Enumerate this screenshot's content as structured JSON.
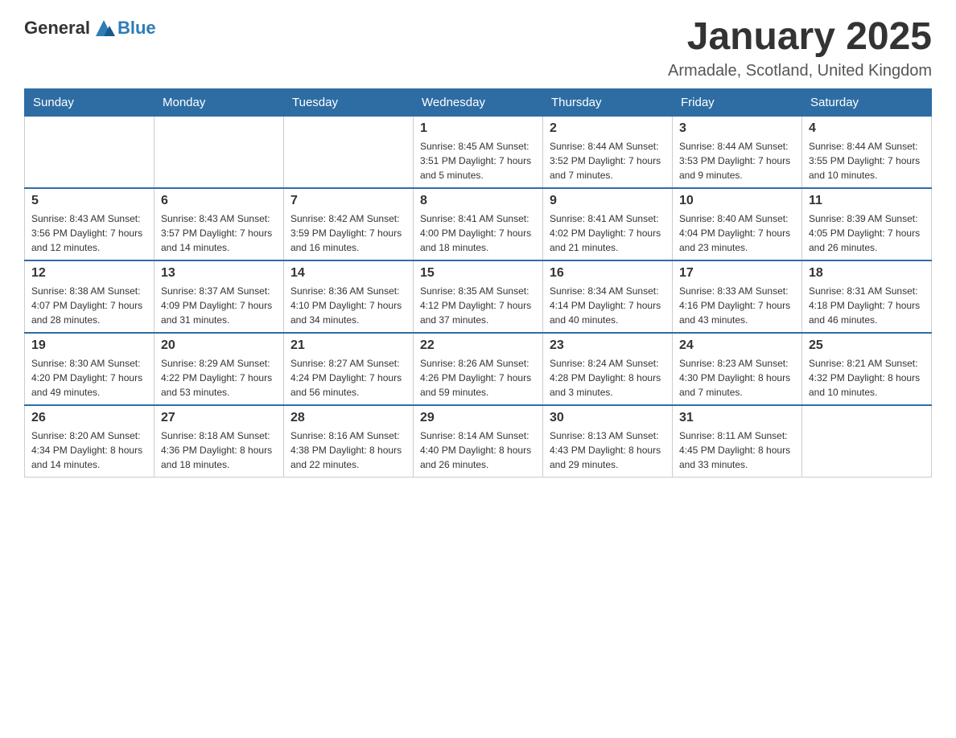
{
  "header": {
    "logo_general": "General",
    "logo_blue": "Blue",
    "month_title": "January 2025",
    "location": "Armadale, Scotland, United Kingdom"
  },
  "weekdays": [
    "Sunday",
    "Monday",
    "Tuesday",
    "Wednesday",
    "Thursday",
    "Friday",
    "Saturday"
  ],
  "weeks": [
    [
      {
        "day": "",
        "info": ""
      },
      {
        "day": "",
        "info": ""
      },
      {
        "day": "",
        "info": ""
      },
      {
        "day": "1",
        "info": "Sunrise: 8:45 AM\nSunset: 3:51 PM\nDaylight: 7 hours\nand 5 minutes."
      },
      {
        "day": "2",
        "info": "Sunrise: 8:44 AM\nSunset: 3:52 PM\nDaylight: 7 hours\nand 7 minutes."
      },
      {
        "day": "3",
        "info": "Sunrise: 8:44 AM\nSunset: 3:53 PM\nDaylight: 7 hours\nand 9 minutes."
      },
      {
        "day": "4",
        "info": "Sunrise: 8:44 AM\nSunset: 3:55 PM\nDaylight: 7 hours\nand 10 minutes."
      }
    ],
    [
      {
        "day": "5",
        "info": "Sunrise: 8:43 AM\nSunset: 3:56 PM\nDaylight: 7 hours\nand 12 minutes."
      },
      {
        "day": "6",
        "info": "Sunrise: 8:43 AM\nSunset: 3:57 PM\nDaylight: 7 hours\nand 14 minutes."
      },
      {
        "day": "7",
        "info": "Sunrise: 8:42 AM\nSunset: 3:59 PM\nDaylight: 7 hours\nand 16 minutes."
      },
      {
        "day": "8",
        "info": "Sunrise: 8:41 AM\nSunset: 4:00 PM\nDaylight: 7 hours\nand 18 minutes."
      },
      {
        "day": "9",
        "info": "Sunrise: 8:41 AM\nSunset: 4:02 PM\nDaylight: 7 hours\nand 21 minutes."
      },
      {
        "day": "10",
        "info": "Sunrise: 8:40 AM\nSunset: 4:04 PM\nDaylight: 7 hours\nand 23 minutes."
      },
      {
        "day": "11",
        "info": "Sunrise: 8:39 AM\nSunset: 4:05 PM\nDaylight: 7 hours\nand 26 minutes."
      }
    ],
    [
      {
        "day": "12",
        "info": "Sunrise: 8:38 AM\nSunset: 4:07 PM\nDaylight: 7 hours\nand 28 minutes."
      },
      {
        "day": "13",
        "info": "Sunrise: 8:37 AM\nSunset: 4:09 PM\nDaylight: 7 hours\nand 31 minutes."
      },
      {
        "day": "14",
        "info": "Sunrise: 8:36 AM\nSunset: 4:10 PM\nDaylight: 7 hours\nand 34 minutes."
      },
      {
        "day": "15",
        "info": "Sunrise: 8:35 AM\nSunset: 4:12 PM\nDaylight: 7 hours\nand 37 minutes."
      },
      {
        "day": "16",
        "info": "Sunrise: 8:34 AM\nSunset: 4:14 PM\nDaylight: 7 hours\nand 40 minutes."
      },
      {
        "day": "17",
        "info": "Sunrise: 8:33 AM\nSunset: 4:16 PM\nDaylight: 7 hours\nand 43 minutes."
      },
      {
        "day": "18",
        "info": "Sunrise: 8:31 AM\nSunset: 4:18 PM\nDaylight: 7 hours\nand 46 minutes."
      }
    ],
    [
      {
        "day": "19",
        "info": "Sunrise: 8:30 AM\nSunset: 4:20 PM\nDaylight: 7 hours\nand 49 minutes."
      },
      {
        "day": "20",
        "info": "Sunrise: 8:29 AM\nSunset: 4:22 PM\nDaylight: 7 hours\nand 53 minutes."
      },
      {
        "day": "21",
        "info": "Sunrise: 8:27 AM\nSunset: 4:24 PM\nDaylight: 7 hours\nand 56 minutes."
      },
      {
        "day": "22",
        "info": "Sunrise: 8:26 AM\nSunset: 4:26 PM\nDaylight: 7 hours\nand 59 minutes."
      },
      {
        "day": "23",
        "info": "Sunrise: 8:24 AM\nSunset: 4:28 PM\nDaylight: 8 hours\nand 3 minutes."
      },
      {
        "day": "24",
        "info": "Sunrise: 8:23 AM\nSunset: 4:30 PM\nDaylight: 8 hours\nand 7 minutes."
      },
      {
        "day": "25",
        "info": "Sunrise: 8:21 AM\nSunset: 4:32 PM\nDaylight: 8 hours\nand 10 minutes."
      }
    ],
    [
      {
        "day": "26",
        "info": "Sunrise: 8:20 AM\nSunset: 4:34 PM\nDaylight: 8 hours\nand 14 minutes."
      },
      {
        "day": "27",
        "info": "Sunrise: 8:18 AM\nSunset: 4:36 PM\nDaylight: 8 hours\nand 18 minutes."
      },
      {
        "day": "28",
        "info": "Sunrise: 8:16 AM\nSunset: 4:38 PM\nDaylight: 8 hours\nand 22 minutes."
      },
      {
        "day": "29",
        "info": "Sunrise: 8:14 AM\nSunset: 4:40 PM\nDaylight: 8 hours\nand 26 minutes."
      },
      {
        "day": "30",
        "info": "Sunrise: 8:13 AM\nSunset: 4:43 PM\nDaylight: 8 hours\nand 29 minutes."
      },
      {
        "day": "31",
        "info": "Sunrise: 8:11 AM\nSunset: 4:45 PM\nDaylight: 8 hours\nand 33 minutes."
      },
      {
        "day": "",
        "info": ""
      }
    ]
  ]
}
